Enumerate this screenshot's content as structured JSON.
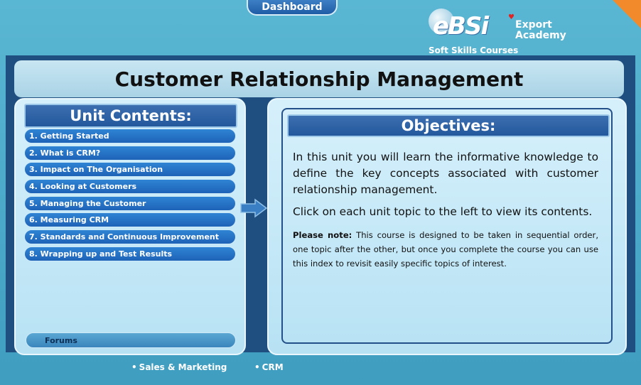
{
  "header": {
    "dashboard_label": "Dashboard",
    "logo": {
      "brand": "eBSi",
      "name_line1": "Export",
      "name_line2": "Academy",
      "subtitle": "Soft Skills Courses"
    }
  },
  "title": "Customer Relationship Management",
  "unit_contents": {
    "heading": "Unit Contents:",
    "items": [
      {
        "label": "1. Getting Started"
      },
      {
        "label": "2. What is CRM?"
      },
      {
        "label": "3. Impact on The Organisation"
      },
      {
        "label": "4. Looking at Customers"
      },
      {
        "label": "5. Managing the Customer"
      },
      {
        "label": "6. Measuring CRM"
      },
      {
        "label": "7. Standards and Continuous Improvement"
      },
      {
        "label": "8. Wrapping up and Test Results"
      }
    ],
    "forums_label": "Forums"
  },
  "objectives": {
    "heading": "Objectives:",
    "paragraph1": "In this unit you will learn the informative knowledge to define the key concepts associated with customer relationship management.",
    "paragraph2": "Click on each unit topic to the left to view its contents.",
    "note_label": "Please note:",
    "note_text": " This course is designed to be taken in sequential order, one topic after the other, but once you complete the course you can use this index to revisit easily specific topics of interest."
  },
  "footer": {
    "bullet": "•",
    "items": [
      "Sales & Marketing",
      "CRM"
    ]
  },
  "colors": {
    "accent_blue": "#1e63b7",
    "corner_orange": "#f28a2c",
    "panel_bg": "#c8e6f2"
  },
  "icons": [
    "arrow-right-icon",
    "heart-icon",
    "globe-icon"
  ]
}
